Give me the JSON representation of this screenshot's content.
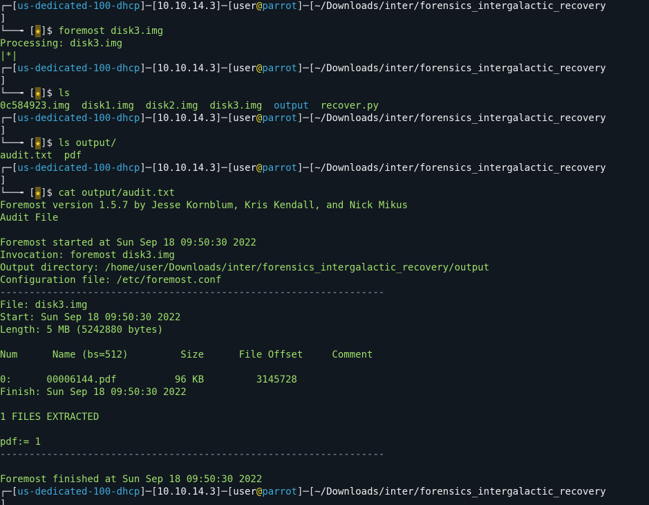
{
  "prompt": {
    "host": "us-dedicated-100-dhcp",
    "ip": "10.10.14.3",
    "user": "user",
    "at": "@",
    "machine": "parrot",
    "path": "~/Downloads/inter/forensics_intergalactic_recovery",
    "star": "★",
    "sigil": "$"
  },
  "blocks": [
    {
      "command": "foremost disk3.img",
      "output": [
        "Processing: disk3.img",
        "|*|"
      ]
    },
    {
      "command": "ls",
      "output_files": [
        {
          "name": "0c584923.img",
          "color": "green"
        },
        {
          "name": "disk1.img",
          "color": "green"
        },
        {
          "name": "disk2.img",
          "color": "green"
        },
        {
          "name": "disk3.img",
          "color": "green"
        },
        {
          "name": "output",
          "color": "blue"
        },
        {
          "name": "recover.py",
          "color": "green"
        }
      ]
    },
    {
      "command": "ls output/",
      "output": [
        "audit.txt  pdf"
      ]
    },
    {
      "command": "cat output/audit.txt",
      "output": [
        "Foremost version 1.5.7 by Jesse Kornblum, Kris Kendall, and Nick Mikus",
        "Audit File",
        "",
        "Foremost started at Sun Sep 18 09:50:30 2022",
        "Invocation: foremost disk3.img",
        "Output directory: /home/user/Downloads/inter/forensics_intergalactic_recovery/output",
        "Configuration file: /etc/foremost.conf",
        "------------------------------------------------------------------",
        "File: disk3.img",
        "Start: Sun Sep 18 09:50:30 2022",
        "Length: 5 MB (5242880 bytes)",
        "",
        "Num      Name (bs=512)         Size      File Offset     Comment",
        "",
        "0:      00006144.pdf          96 KB         3145728",
        "Finish: Sun Sep 18 09:50:30 2022",
        "",
        "1 FILES EXTRACTED",
        "",
        "pdf:= 1",
        "------------------------------------------------------------------",
        "",
        "Foremost finished at Sun Sep 18 09:50:30 2022"
      ]
    }
  ],
  "colors": {
    "background": "#111820",
    "text": "#9fde6a",
    "host": "#3fa9d8",
    "at": "#e8d93a",
    "star": "#ffd21f"
  }
}
